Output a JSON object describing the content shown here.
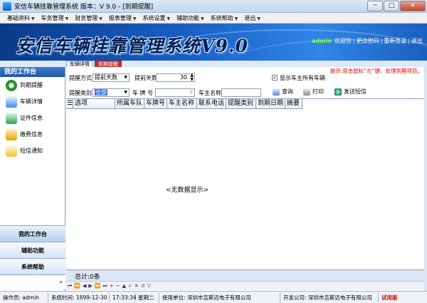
{
  "window": {
    "title": "安信车辆挂靠管理系统  版本：V 9.0 - [到期提醒]",
    "minimize": "─",
    "maximize": "□",
    "close": "✕"
  },
  "menu": [
    {
      "label": "基础资料"
    },
    {
      "label": "车务管理"
    },
    {
      "label": "财务管理"
    },
    {
      "label": "报表管理"
    },
    {
      "label": "系统设置"
    },
    {
      "label": "辅助功能"
    },
    {
      "label": "系统帮助"
    },
    {
      "label": "退出"
    }
  ],
  "banner": {
    "title": "安信车辆挂靠管理系统V9.0",
    "user": "admin",
    "links": {
      "welcome": "欢迎您",
      "change_password": "更改密码",
      "relogin": "重新登录",
      "exit": "退出"
    }
  },
  "tabs": [
    {
      "label": "车辆详情",
      "active": false
    },
    {
      "label": "到期提醒",
      "active": true
    }
  ],
  "sidebar": {
    "header": "我的工作台",
    "items": [
      {
        "label": "到期提醒",
        "icon": "clock-icon"
      },
      {
        "label": "车辆详情",
        "icon": "car-icon"
      },
      {
        "label": "证件信息",
        "icon": "document-icon"
      },
      {
        "label": "缴费信息",
        "icon": "money-icon"
      },
      {
        "label": "短信通知",
        "icon": "sms-icon"
      }
    ],
    "bottom_buttons": [
      {
        "label": "我的工作台",
        "active": true
      },
      {
        "label": "辅助功能",
        "active": false
      },
      {
        "label": "系统帮助",
        "active": false
      }
    ],
    "expand_arrow": "»"
  },
  "hint": "提示:双击鼠标“左”键，处理到期项目。",
  "filter": {
    "remind_mode_label": "提醒方式:",
    "remind_mode_value": "提前天数",
    "days_ahead_label": "提前天数:",
    "days_ahead_value": "30",
    "show_all_label": "显示车主所有车辆",
    "show_all_checked": true,
    "remind_type_label": "提醒类别",
    "remind_type_value": "全部",
    "plate_label": "车 牌 号",
    "owner_label": "车主名称",
    "query": "查询",
    "print": "打印",
    "send_sms": "发送短信"
  },
  "grid": {
    "columns": [
      "选项",
      "所属车队",
      "车牌号",
      "车主名称",
      "联系电话",
      "提醒类别",
      "到期日期",
      "摘要"
    ],
    "empty_text": "<无数据显示>",
    "total": "总计:0条"
  },
  "navigator": [
    "⏮",
    "⏪",
    "◀",
    "▶",
    "⏩",
    "⏭",
    "+",
    "−",
    "▲",
    "✓",
    "✕",
    "↺",
    "▽"
  ],
  "status": {
    "operator": "操作员: admin",
    "system_time": "系统时间: 1899-12-30",
    "clock": "17:33:34",
    "weekday": "星期二",
    "user_unit": "使用单位: 深圳市吉斯迈电子有限公司",
    "developer": "开发公司: 深圳市吉斯迈电子有限公司",
    "trial": "试用版"
  }
}
